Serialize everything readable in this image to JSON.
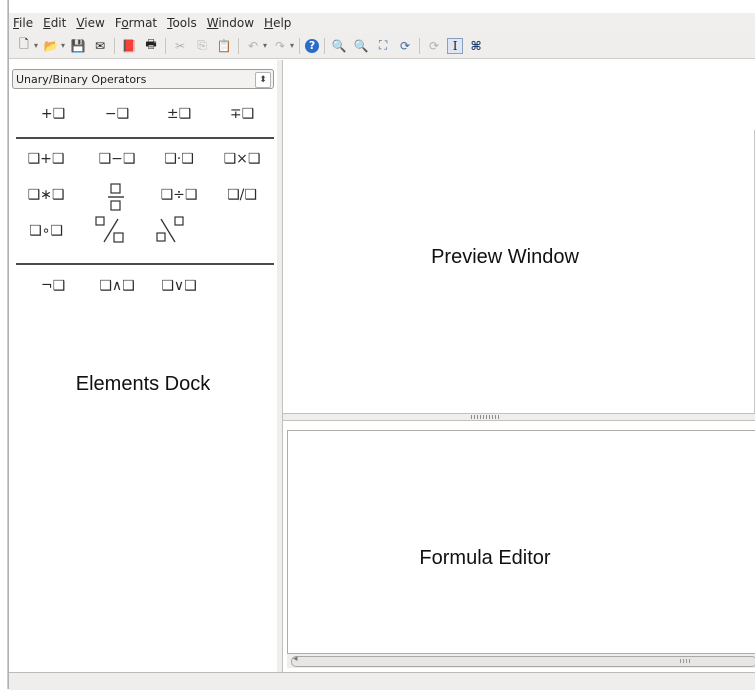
{
  "menu": [
    {
      "prefix": "",
      "accel": "F",
      "rest": "ile"
    },
    {
      "prefix": "",
      "accel": "E",
      "rest": "dit"
    },
    {
      "prefix": "",
      "accel": "V",
      "rest": "iew"
    },
    {
      "prefix": "F",
      "accel": "o",
      "rest": "rmat"
    },
    {
      "prefix": "",
      "accel": "T",
      "rest": "ools"
    },
    {
      "prefix": "",
      "accel": "W",
      "rest": "indow"
    },
    {
      "prefix": "",
      "accel": "H",
      "rest": "elp"
    }
  ],
  "toolbar_glyphs": {
    "new": "🗋",
    "open": "📂",
    "save": "💾",
    "email": "✉",
    "pdf": "📕",
    "print": "🖶",
    "cut": "✂",
    "copy": "⎘",
    "paste": "📋",
    "undo": "↶",
    "redo": "↷",
    "help": "?",
    "zoom_in": "🔍",
    "zoom_out": "🔍",
    "show_all": "⛶",
    "update": "⟳",
    "formula_cursor": "I",
    "symbols": "⌘",
    "dropdown": "▾"
  },
  "colors": {
    "accent_help": "#2a6cc9",
    "accent_open": "#e8a32a",
    "accent_pdf": "#c0392b"
  },
  "dock": {
    "category": "Unary/Binary Operators",
    "spinner": "⬍",
    "rows": [
      [
        "+❑",
        "−❑",
        "±❑",
        "∓❑"
      ],
      [
        "❑+❑",
        "❑−❑",
        "❑·❑",
        "❑×❑"
      ],
      [
        "❑∗❑",
        "❑̅❑",
        "❑÷❑",
        "❑/❑"
      ],
      [
        "❑∘❑",
        "❑∕❑",
        "❑∖❑"
      ],
      [
        "¬❑",
        "❑∧❑",
        "❑∨❑"
      ]
    ],
    "label": "Elements Dock"
  },
  "preview": {
    "label": "Preview Window"
  },
  "editor": {
    "label": "Formula Editor",
    "scroll_left": "◂"
  }
}
